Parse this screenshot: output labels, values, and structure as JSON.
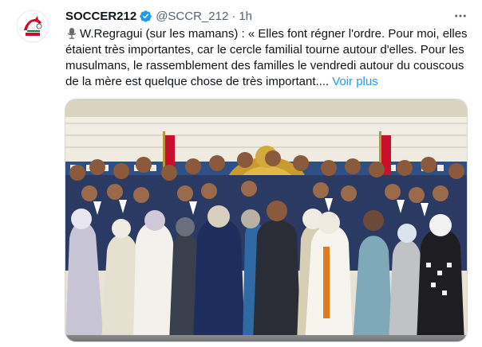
{
  "tweet": {
    "author": {
      "display_name": "SOCCER212",
      "handle": "@SCCR_212",
      "verified": true,
      "avatar_icon": "soccer212-logo-icon"
    },
    "separator": "·",
    "timestamp": "1h",
    "more_icon": "more-dots-icon",
    "lead_icon": "microphone-icon",
    "text": "W.Regragui (sur les mamans) : « Elles font régner l'ordre. Pour moi, elles étaient très importantes, car le cercle familial tourne autour d'elles. Pour les musulmans, le rassemblement des familles le vendredi autour du couscous de la mère est quelque chose de très important....",
    "show_more": "Voir plus",
    "media": {
      "icon": "group-photo-image"
    }
  },
  "colors": {
    "text": "#0f1419",
    "secondary": "#536471",
    "link": "#1d9bf0",
    "verified_badge": "#1d9bf0"
  }
}
